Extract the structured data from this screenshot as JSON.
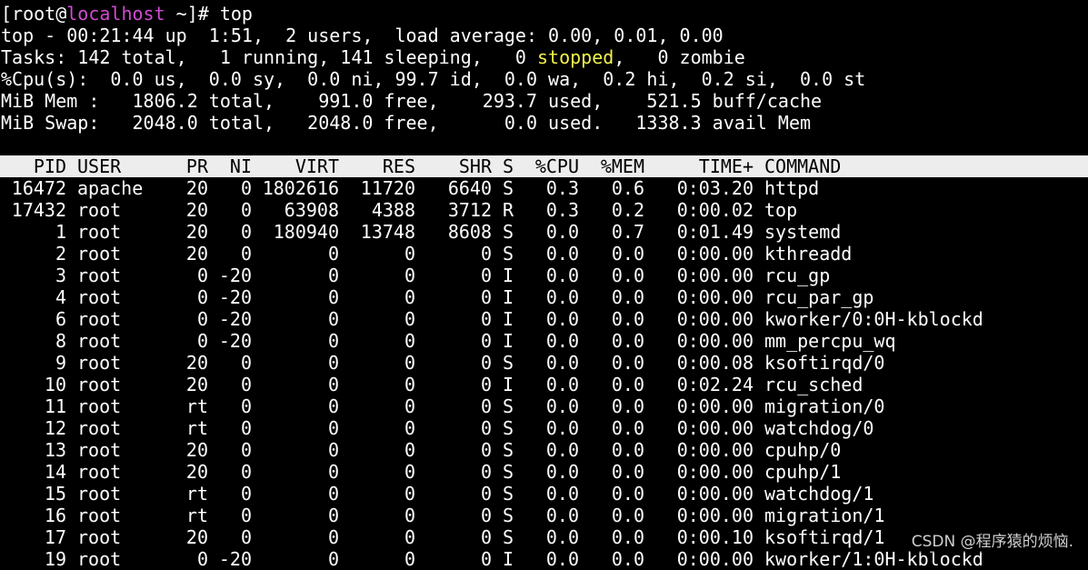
{
  "prompt": {
    "open": "[root@",
    "host": "localhost",
    "rest": " ~]# top"
  },
  "summary": {
    "uptime_line": "top - 00:21:44 up  1:51,  2 users,  load average: 0.00, 0.01, 0.00",
    "tasks_pre": "Tasks: 142 total,   1 running, 141 sleeping,   0 ",
    "tasks_stopped_word": "stopped",
    "tasks_post": ",   0 zombie",
    "cpu_line": "%Cpu(s):  0.0 us,  0.0 sy,  0.0 ni, 99.7 id,  0.0 wa,  0.2 hi,  0.2 si,  0.0 st",
    "mem_line": "MiB Mem :   1806.2 total,    991.0 free,    293.7 used,    521.5 buff/cache",
    "swap_line": "MiB Swap:   2048.0 total,   2048.0 free,      0.0 used.   1338.3 avail Mem"
  },
  "table": {
    "headers": {
      "pid": "PID",
      "user": "USER",
      "pr": "PR",
      "ni": "NI",
      "virt": "VIRT",
      "res": "RES",
      "shr": "SHR",
      "s": "S",
      "cpu": "%CPU",
      "mem": "%MEM",
      "time": "TIME+",
      "command": "COMMAND"
    },
    "rows": [
      {
        "pid": "16472",
        "user": "apache",
        "pr": "20",
        "ni": "0",
        "virt": "1802616",
        "res": "11720",
        "shr": "6640",
        "s": "S",
        "cpu": "0.3",
        "mem": "0.6",
        "time": "0:03.20",
        "command": "httpd"
      },
      {
        "pid": "17432",
        "user": "root",
        "pr": "20",
        "ni": "0",
        "virt": "63908",
        "res": "4388",
        "shr": "3712",
        "s": "R",
        "cpu": "0.3",
        "mem": "0.2",
        "time": "0:00.02",
        "command": "top"
      },
      {
        "pid": "1",
        "user": "root",
        "pr": "20",
        "ni": "0",
        "virt": "180940",
        "res": "13748",
        "shr": "8608",
        "s": "S",
        "cpu": "0.0",
        "mem": "0.7",
        "time": "0:01.49",
        "command": "systemd"
      },
      {
        "pid": "2",
        "user": "root",
        "pr": "20",
        "ni": "0",
        "virt": "0",
        "res": "0",
        "shr": "0",
        "s": "S",
        "cpu": "0.0",
        "mem": "0.0",
        "time": "0:00.00",
        "command": "kthreadd"
      },
      {
        "pid": "3",
        "user": "root",
        "pr": "0",
        "ni": "-20",
        "virt": "0",
        "res": "0",
        "shr": "0",
        "s": "I",
        "cpu": "0.0",
        "mem": "0.0",
        "time": "0:00.00",
        "command": "rcu_gp"
      },
      {
        "pid": "4",
        "user": "root",
        "pr": "0",
        "ni": "-20",
        "virt": "0",
        "res": "0",
        "shr": "0",
        "s": "I",
        "cpu": "0.0",
        "mem": "0.0",
        "time": "0:00.00",
        "command": "rcu_par_gp"
      },
      {
        "pid": "6",
        "user": "root",
        "pr": "0",
        "ni": "-20",
        "virt": "0",
        "res": "0",
        "shr": "0",
        "s": "I",
        "cpu": "0.0",
        "mem": "0.0",
        "time": "0:00.00",
        "command": "kworker/0:0H-kblockd"
      },
      {
        "pid": "8",
        "user": "root",
        "pr": "0",
        "ni": "-20",
        "virt": "0",
        "res": "0",
        "shr": "0",
        "s": "I",
        "cpu": "0.0",
        "mem": "0.0",
        "time": "0:00.00",
        "command": "mm_percpu_wq"
      },
      {
        "pid": "9",
        "user": "root",
        "pr": "20",
        "ni": "0",
        "virt": "0",
        "res": "0",
        "shr": "0",
        "s": "S",
        "cpu": "0.0",
        "mem": "0.0",
        "time": "0:00.08",
        "command": "ksoftirqd/0"
      },
      {
        "pid": "10",
        "user": "root",
        "pr": "20",
        "ni": "0",
        "virt": "0",
        "res": "0",
        "shr": "0",
        "s": "I",
        "cpu": "0.0",
        "mem": "0.0",
        "time": "0:02.24",
        "command": "rcu_sched"
      },
      {
        "pid": "11",
        "user": "root",
        "pr": "rt",
        "ni": "0",
        "virt": "0",
        "res": "0",
        "shr": "0",
        "s": "S",
        "cpu": "0.0",
        "mem": "0.0",
        "time": "0:00.00",
        "command": "migration/0"
      },
      {
        "pid": "12",
        "user": "root",
        "pr": "rt",
        "ni": "0",
        "virt": "0",
        "res": "0",
        "shr": "0",
        "s": "S",
        "cpu": "0.0",
        "mem": "0.0",
        "time": "0:00.00",
        "command": "watchdog/0"
      },
      {
        "pid": "13",
        "user": "root",
        "pr": "20",
        "ni": "0",
        "virt": "0",
        "res": "0",
        "shr": "0",
        "s": "S",
        "cpu": "0.0",
        "mem": "0.0",
        "time": "0:00.00",
        "command": "cpuhp/0"
      },
      {
        "pid": "14",
        "user": "root",
        "pr": "20",
        "ni": "0",
        "virt": "0",
        "res": "0",
        "shr": "0",
        "s": "S",
        "cpu": "0.0",
        "mem": "0.0",
        "time": "0:00.00",
        "command": "cpuhp/1"
      },
      {
        "pid": "15",
        "user": "root",
        "pr": "rt",
        "ni": "0",
        "virt": "0",
        "res": "0",
        "shr": "0",
        "s": "S",
        "cpu": "0.0",
        "mem": "0.0",
        "time": "0:00.00",
        "command": "watchdog/1"
      },
      {
        "pid": "16",
        "user": "root",
        "pr": "rt",
        "ni": "0",
        "virt": "0",
        "res": "0",
        "shr": "0",
        "s": "S",
        "cpu": "0.0",
        "mem": "0.0",
        "time": "0:00.00",
        "command": "migration/1"
      },
      {
        "pid": "17",
        "user": "root",
        "pr": "20",
        "ni": "0",
        "virt": "0",
        "res": "0",
        "shr": "0",
        "s": "S",
        "cpu": "0.0",
        "mem": "0.0",
        "time": "0:00.10",
        "command": "ksoftirqd/1"
      },
      {
        "pid": "19",
        "user": "root",
        "pr": "0",
        "ni": "-20",
        "virt": "0",
        "res": "0",
        "shr": "0",
        "s": "I",
        "cpu": "0.0",
        "mem": "0.0",
        "time": "0:00.00",
        "command": "kworker/1:0H-kblockd"
      }
    ]
  },
  "watermark": "CSDN @程序猿的烦恼.",
  "colors": {
    "background": "#000000",
    "text": "#ffffff",
    "hostname": "#d14bd1",
    "stopped": "#f2f24a",
    "header_bg": "#ededed"
  }
}
